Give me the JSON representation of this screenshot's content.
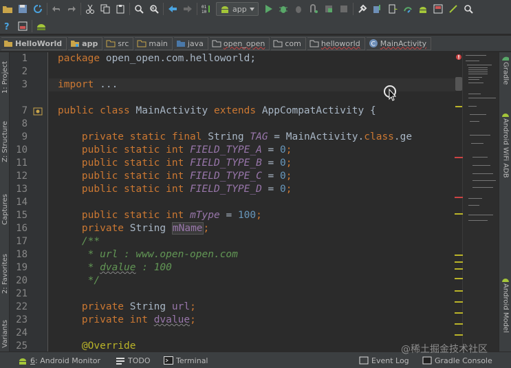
{
  "toolbar": {
    "run_config": "app",
    "row1_icons": [
      "open-icon",
      "save-icon",
      "sync-icon",
      "undo-icon",
      "redo-icon",
      "cut-icon",
      "copy-icon",
      "paste-icon",
      "find-icon",
      "replace-icon",
      "back-icon",
      "forward-icon",
      "binary-icon",
      "run-config-icon",
      "run-icon",
      "debug-icon",
      "attach-icon",
      "apply-changes-icon",
      "coverage-icon",
      "stop-icon",
      "project-structure-icon",
      "sdk-manager-icon",
      "avd-icon",
      "sync-gradle-icon",
      "android-device-monitor-icon",
      "theme-icon"
    ],
    "row2_icons": [
      "help-icon",
      "settings-icon",
      "android-icon"
    ]
  },
  "breadcrumb": {
    "items": [
      {
        "label": "HelloWorld",
        "icon": "project-icon",
        "bold": true
      },
      {
        "label": "app",
        "icon": "module-icon",
        "bold": true
      },
      {
        "label": "src",
        "icon": "folder-icon"
      },
      {
        "label": "main",
        "icon": "folder-icon"
      },
      {
        "label": "java",
        "icon": "source-folder-icon"
      },
      {
        "label": "open_open",
        "icon": "package-icon"
      },
      {
        "label": "com",
        "icon": "package-icon"
      },
      {
        "label": "helloworld",
        "icon": "package-icon"
      },
      {
        "label": "MainActivity",
        "icon": "class-icon"
      }
    ]
  },
  "left_tabs": {
    "project": "1: Project",
    "structure": "Z: Structure",
    "captures": "Captures",
    "favorites": "2: Favorites",
    "variants": "Variants"
  },
  "right_tabs": {
    "gradle": "Gradle",
    "wifi_adb": "Android WiFi ADB",
    "android_model": "Android Model"
  },
  "editor": {
    "line_numbers": [
      "1",
      "2",
      "3",
      "7",
      "8",
      "9",
      "10",
      "11",
      "12",
      "13",
      "14",
      "15",
      "16",
      "17",
      "18",
      "19",
      "20",
      "21",
      "22",
      "23",
      "24",
      "25"
    ],
    "lines": {
      "l1_kw": "package",
      "l1_rest": " open_open.com.helloworld;",
      "l3_kw": "import",
      "l3_rest": " ...",
      "l7_kw1": "public class",
      "l7_cls": " MainActivity ",
      "l7_kw2": "extends",
      "l7_rest": " AppCompatActivity {",
      "l9_kw": "private static final",
      "l9_type": " String ",
      "l9_name": "TAG",
      "l9_eq": " = MainActivity.",
      "l9_kw2": "class",
      "l9_rest": ".ge",
      "l10_kw": "public static int ",
      "l10_name": "FIELD_TYPE_A",
      "l10_eq": " = ",
      "l10_num": "0",
      "l10_end": ";",
      "l11_kw": "public static int ",
      "l11_name": "FIELD_TYPE_B",
      "l11_eq": " = ",
      "l11_num": "0",
      "l11_end": ";",
      "l12_kw": "public static int ",
      "l12_name": "FIELD_TYPE_C",
      "l12_eq": " = ",
      "l12_num": "0",
      "l12_end": ";",
      "l13_kw": "public static int ",
      "l13_name": "FIELD_TYPE_D",
      "l13_eq": " = ",
      "l13_num": "0",
      "l13_end": ";",
      "l15_kw": "public static int ",
      "l15_name": "mType",
      "l15_eq": " = ",
      "l15_num": "100",
      "l15_end": ";",
      "l16_kw": "private",
      "l16_type": " String ",
      "l16_name": "mName",
      "l16_end": ";",
      "l17": "/**",
      "l18": " * url : www.open-open.com",
      "l19_a": " * ",
      "l19_b": "dvalue",
      "l19_c": " : 100",
      "l20": " */",
      "l22_kw": "private",
      "l22_type": " String ",
      "l22_name": "url",
      "l22_end": ";",
      "l23_kw": "private int ",
      "l23_name": "dvalue",
      "l23_end": ";",
      "l25": "@Override"
    }
  },
  "statusbar": {
    "android_monitor_num": "6",
    "android_monitor": ": Android Monitor",
    "todo": "TODO",
    "terminal": "Terminal",
    "event_log": "Event Log",
    "gradle_console": "Gradle Console"
  },
  "watermark": "@稀土掘金技术社区",
  "colors": {
    "keyword": "#cc7832",
    "field": "#9876aa",
    "number": "#6897bb",
    "comment": "#629755",
    "annotation": "#bbb529",
    "text": "#a9b7c6",
    "background": "#2b2b2b"
  }
}
